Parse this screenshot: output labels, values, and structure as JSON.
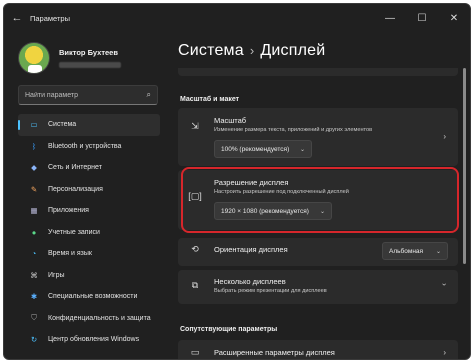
{
  "window": {
    "title": "Параметры",
    "back_icon": "arrow-left-icon",
    "controls": [
      "minimize",
      "maximize",
      "close"
    ]
  },
  "profile": {
    "name": "Виктор Бухтеев"
  },
  "search": {
    "placeholder": "Найти параметр"
  },
  "sidebar": {
    "items": [
      {
        "label": "Система",
        "icon": "monitor-icon",
        "active": true
      },
      {
        "label": "Bluetooth и устройства",
        "icon": "bluetooth-icon"
      },
      {
        "label": "Сеть и Интернет",
        "icon": "wifi-icon"
      },
      {
        "label": "Персонализация",
        "icon": "brush-icon"
      },
      {
        "label": "Приложения",
        "icon": "apps-icon"
      },
      {
        "label": "Учетные записи",
        "icon": "person-icon"
      },
      {
        "label": "Время и язык",
        "icon": "globe-clock-icon"
      },
      {
        "label": "Игры",
        "icon": "gamepad-icon"
      },
      {
        "label": "Специальные возможности",
        "icon": "accessibility-icon"
      },
      {
        "label": "Конфиденциальность и защита",
        "icon": "shield-icon"
      },
      {
        "label": "Центр обновления Windows",
        "icon": "update-icon"
      }
    ]
  },
  "breadcrumb": {
    "parent": "Система",
    "separator": "›",
    "current": "Дисплей"
  },
  "sections": {
    "scale_layout": "Масштаб и макет",
    "related": "Сопутствующие параметры"
  },
  "scale": {
    "title": "Масштаб",
    "subtitle": "Изменение размера текста, приложений и других элементов",
    "value": "100% (рекомендуется)"
  },
  "resolution": {
    "title": "Разрешение дисплея",
    "subtitle": "Настроить разрешение под подключенный дисплей",
    "value": "1920 × 1080 (рекомендуется)"
  },
  "orientation": {
    "title": "Ориентация дисплея",
    "value": "Альбомная"
  },
  "multiple": {
    "title": "Несколько дисплеев",
    "subtitle": "Выбрать режим презентации для дисплеев"
  },
  "advanced": {
    "title": "Расширенные параметры дисплея"
  },
  "colors": {
    "accent": "#4cc2ff",
    "highlight": "#d6262b",
    "window_bg": "#202020",
    "card_bg": "#2b2b2b"
  }
}
